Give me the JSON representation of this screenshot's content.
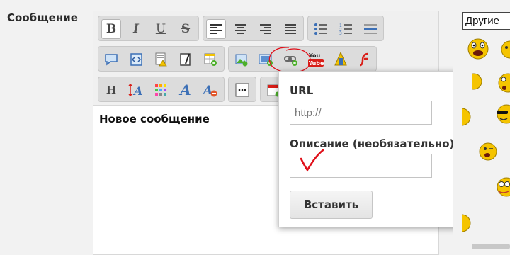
{
  "form": {
    "message_label": "Сообщение"
  },
  "editor": {
    "content": "Новое сообщение",
    "toolbar": {
      "row1": [
        "bold",
        "italic",
        "underline",
        "strikethrough",
        "align-left",
        "align-center",
        "align-right",
        "justify",
        "bullet-list",
        "numbered-list",
        "horizontal-rule"
      ],
      "row2": [
        "quote",
        "code",
        "spoiler",
        "indent",
        "table",
        "image",
        "image-upload",
        "link",
        "youtube",
        "attachment",
        "flash"
      ],
      "row3": [
        "heading",
        "font-size",
        "color",
        "font",
        "remove-format",
        "more",
        "date"
      ],
      "bold_glyph": "B",
      "italic_glyph": "I",
      "underline_glyph": "U",
      "strike_glyph": "S",
      "heading_glyph": "H",
      "font_glyph": "A",
      "youtube_top": "You",
      "youtube_bottom": "Tube"
    }
  },
  "link_popup": {
    "url_label": "URL",
    "url_placeholder": "http://",
    "description_label": "Описание (необязательно)",
    "description_value": "",
    "insert_button": "Вставить"
  },
  "smilies": {
    "tab_label": "Другие"
  },
  "colors": {
    "accent_red": "#e0101a",
    "smiley_yellow": "#f5c400",
    "toolbar_bg": "#f0f0f0",
    "group_bg": "#dcdcdc"
  }
}
